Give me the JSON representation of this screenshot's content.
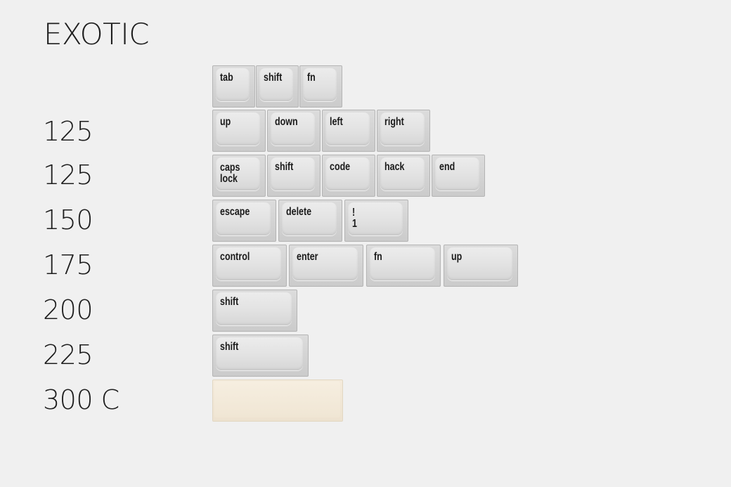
{
  "title": "EXOTIC",
  "row_labels": [
    "125",
    "125",
    "150",
    "175",
    "200",
    "225",
    "300 C"
  ],
  "keys": {
    "r0": [
      "tab",
      "shift",
      "fn"
    ],
    "r1": [
      "up",
      "down",
      "left",
      "right"
    ],
    "r2": [
      "caps\nlock",
      "shift",
      "code",
      "hack",
      "end"
    ],
    "r3": [
      "escape",
      "delete",
      "!\n1"
    ],
    "r4": [
      "control",
      "enter",
      "fn",
      "up"
    ],
    "r5": [
      "shift"
    ],
    "r6": [
      "shift"
    ],
    "r7": [
      ""
    ]
  },
  "colors": {
    "background": "#f0f0f0",
    "keycap_gray": "#e4e4e4",
    "spacebar_cream": "#f3ead9",
    "legend": "#1a1a1a"
  }
}
